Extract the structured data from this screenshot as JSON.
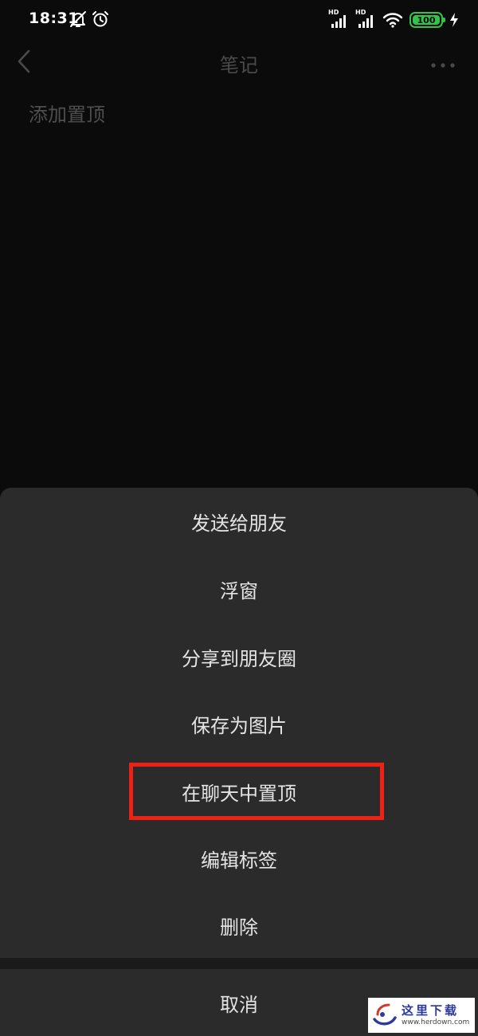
{
  "status_bar": {
    "time": "18:31",
    "battery": "100",
    "signal_badge": "HD",
    "battery_color": "#36c24a"
  },
  "header": {
    "title": "笔记"
  },
  "note": {
    "text": "添加置顶"
  },
  "sheet": {
    "items": [
      {
        "label": "发送给朋友"
      },
      {
        "label": "浮窗"
      },
      {
        "label": "分享到朋友圈"
      },
      {
        "label": "保存为图片"
      },
      {
        "label": "在聊天中置顶"
      },
      {
        "label": "编辑标签"
      },
      {
        "label": "删除"
      }
    ],
    "cancel_label": "取消",
    "highlight_color": "#ee2214"
  },
  "watermark": {
    "cn": "这里下载",
    "en": "www.herdown.com"
  }
}
